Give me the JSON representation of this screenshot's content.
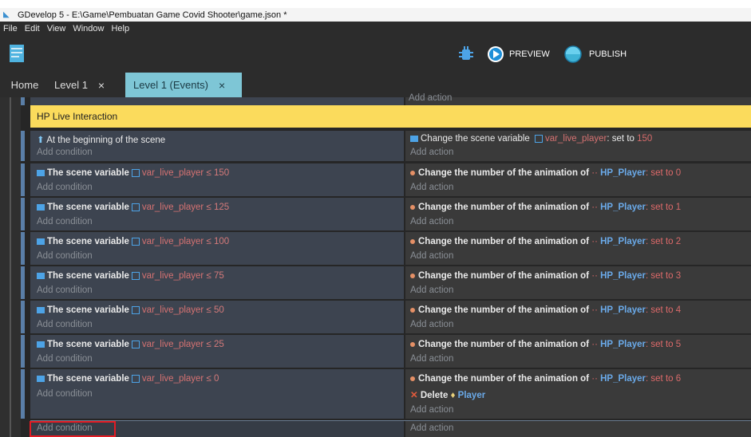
{
  "window": {
    "title": "GDevelop 5 - E:\\Game\\Pembuatan Game Covid Shooter\\game.json *"
  },
  "menu": [
    "File",
    "Edit",
    "View",
    "Window",
    "Help"
  ],
  "toolbar": {
    "preview_label": "PREVIEW",
    "publish_label": "PUBLISH"
  },
  "tabs": [
    {
      "label": "Home",
      "closable": false,
      "active": false
    },
    {
      "label": "Level 1",
      "closable": true,
      "active": false
    },
    {
      "label": "Level 1 (Events)",
      "closable": true,
      "active": true
    }
  ],
  "close_glyph": "×",
  "events": {
    "top_add_action": "Add action",
    "comment": "HP Live Interaction",
    "add_condition": "Add condition",
    "add_action": "Add action",
    "first": {
      "condition": "At the beginning of the scene",
      "action_text": "Change the scene variable",
      "action_var": "var_live_player",
      "action_set": ": set to",
      "action_value": "150"
    },
    "condition_prefix": "The scene variable",
    "variable": "var_live_player",
    "operator": "≤",
    "action_prefix": "Change the number of the animation of",
    "object": "HP_Player",
    "set_to": ": set to",
    "rows": [
      {
        "threshold": "150",
        "animation": "0"
      },
      {
        "threshold": "125",
        "animation": "1"
      },
      {
        "threshold": "100",
        "animation": "2"
      },
      {
        "threshold": "75",
        "animation": "3"
      },
      {
        "threshold": "50",
        "animation": "4"
      },
      {
        "threshold": "25",
        "animation": "5"
      },
      {
        "threshold": "0",
        "animation": "6"
      }
    ],
    "delete_label": "Delete",
    "delete_object": "Player",
    "bottom_add_condition": "Add condition",
    "bottom_add_action": "Add action"
  },
  "colors": {
    "comment_bg": "#fbdb5c",
    "active_tab": "#7ec6d6",
    "highlight_box": "#e31b23"
  }
}
